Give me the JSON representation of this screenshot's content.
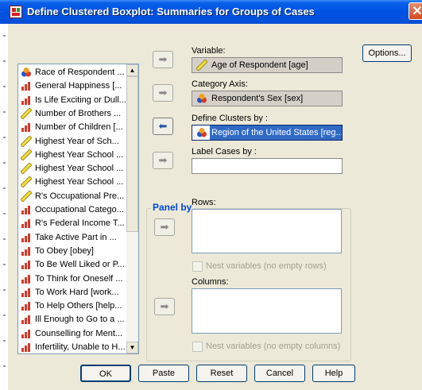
{
  "window": {
    "title": "Define Clustered Boxplot: Summaries for Groups of Cases",
    "close_label": "✕"
  },
  "variables_list": [
    {
      "label": "Race of Respondent ...",
      "icon": "nominal-icon"
    },
    {
      "label": "General Happiness [...",
      "icon": "ordinal-icon"
    },
    {
      "label": "Is Life Exciting or Dull...",
      "icon": "ordinal-icon"
    },
    {
      "label": "Number of Brothers ...",
      "icon": "scale-icon"
    },
    {
      "label": "Number of Children [...",
      "icon": "ordinal-icon"
    },
    {
      "label": "Highest Year of Sch...",
      "icon": "scale-icon"
    },
    {
      "label": "Highest Year School ...",
      "icon": "scale-icon"
    },
    {
      "label": "Highest Year School ...",
      "icon": "scale-icon"
    },
    {
      "label": "Highest Year School ...",
      "icon": "scale-icon"
    },
    {
      "label": "R's Occupational Pre...",
      "icon": "scale-icon"
    },
    {
      "label": "Occupational Catego...",
      "icon": "ordinal-icon"
    },
    {
      "label": "R's Federal Income T...",
      "icon": "ordinal-icon"
    },
    {
      "label": "Take Active Part in ...",
      "icon": "ordinal-icon"
    },
    {
      "label": "To Obey [obey]",
      "icon": "ordinal-icon"
    },
    {
      "label": "To Be Well Liked or P...",
      "icon": "ordinal-icon"
    },
    {
      "label": "To Think for Oneself ...",
      "icon": "ordinal-icon"
    },
    {
      "label": "To Work Hard [work...",
      "icon": "ordinal-icon"
    },
    {
      "label": "To Help Others [help...",
      "icon": "ordinal-icon"
    },
    {
      "label": "Ill Enough to Go to a ...",
      "icon": "ordinal-icon"
    },
    {
      "label": "Counselling for Ment...",
      "icon": "ordinal-icon"
    },
    {
      "label": "Infertility, Unable to H...",
      "icon": "ordinal-icon"
    }
  ],
  "variable": {
    "label": "Variable:",
    "value": "Age of Respondent [age]",
    "icon": "scale-icon"
  },
  "category_axis": {
    "label": "Category Axis:",
    "value": "Respondent's Sex [sex]",
    "icon": "nominal-icon"
  },
  "define_clusters": {
    "label": "Define Clusters by :",
    "value": "Region of the United States [reg...",
    "icon": "nominal-icon"
  },
  "label_cases": {
    "label": "Label Cases by :",
    "value": ""
  },
  "panel_by": {
    "title": "Panel by",
    "rows_label": "Rows:",
    "rows_nest": "Nest variables (no empty rows)",
    "columns_label": "Columns:",
    "columns_nest": "Nest variables (no empty columns)"
  },
  "buttons": {
    "options": "Options...",
    "ok": "OK",
    "paste": "Paste",
    "reset": "Reset",
    "cancel": "Cancel",
    "help": "Help"
  },
  "arrows": {
    "right": "➡",
    "left": "⬅"
  }
}
